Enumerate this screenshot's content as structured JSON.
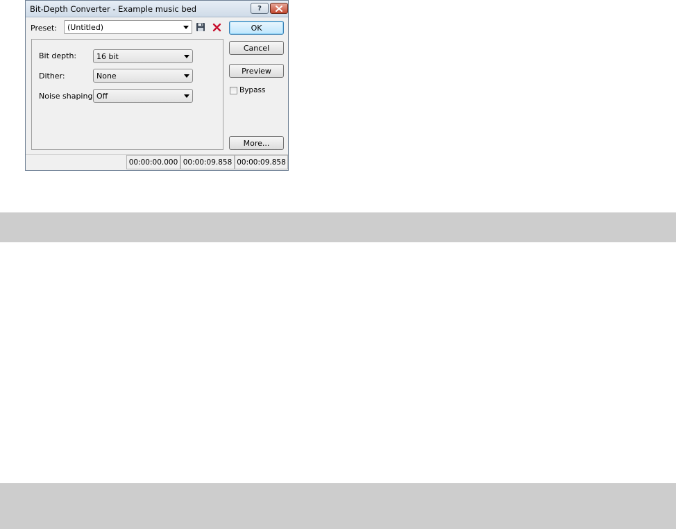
{
  "window": {
    "title": "Bit-Depth Converter - Example music bed",
    "help_symbol": "?",
    "close_icon": "close-icon"
  },
  "preset": {
    "label": "Preset:",
    "value": "(Untitled)",
    "save_icon": "floppy-disk-icon",
    "delete_icon": "delete-x-icon"
  },
  "settings": {
    "bit_depth": {
      "label": "Bit depth:",
      "value": "16 bit"
    },
    "dither": {
      "label": "Dither:",
      "value": "None"
    },
    "noise_shaping": {
      "label": "Noise shaping:",
      "value": "Off"
    }
  },
  "buttons": {
    "ok": "OK",
    "cancel": "Cancel",
    "preview": "Preview",
    "more": "More..."
  },
  "bypass": {
    "label": "Bypass",
    "checked": false
  },
  "status": {
    "start": "00:00:00.000",
    "end": "00:00:09.858",
    "length": "00:00:09.858"
  },
  "colors": {
    "delete_icon": "#c8102e",
    "band": "#cdcdcd",
    "dialog_bg": "#f0f0f0"
  }
}
